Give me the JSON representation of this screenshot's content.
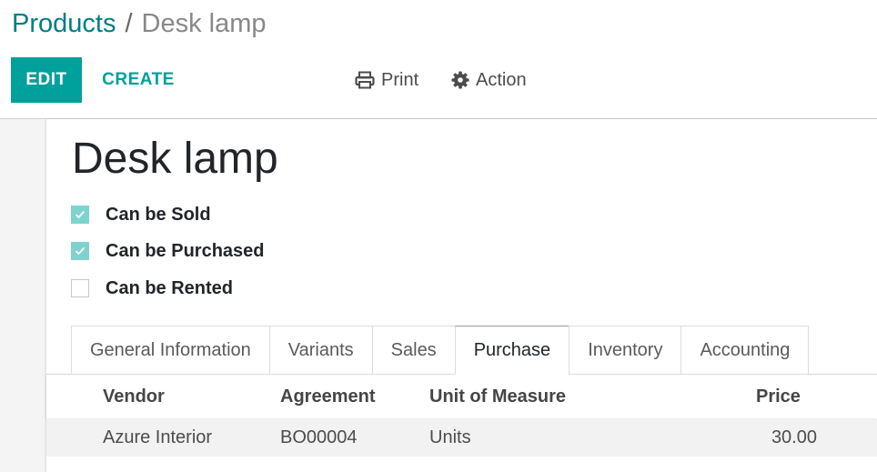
{
  "breadcrumb": {
    "parent": "Products",
    "separator": "/",
    "current": "Desk lamp"
  },
  "toolbar": {
    "edit_label": "EDIT",
    "create_label": "CREATE",
    "print_label": "Print",
    "action_label": "Action"
  },
  "icons": {
    "print": "print-icon",
    "action": "gear-icon"
  },
  "colors": {
    "primary": "#00a09d",
    "breadcrumb_link": "#017e84",
    "checkbox_checked": "#7ed3cf"
  },
  "product": {
    "name": "Desk lamp",
    "options": [
      {
        "label": "Can be Sold",
        "checked": true
      },
      {
        "label": "Can be Purchased",
        "checked": true
      },
      {
        "label": "Can be Rented",
        "checked": false
      }
    ]
  },
  "tabs": [
    {
      "label": "General Information",
      "active": false
    },
    {
      "label": "Variants",
      "active": false
    },
    {
      "label": "Sales",
      "active": false
    },
    {
      "label": "Purchase",
      "active": true
    },
    {
      "label": "Inventory",
      "active": false
    },
    {
      "label": "Accounting",
      "active": false
    }
  ],
  "vendor_table": {
    "columns": {
      "vendor": "Vendor",
      "agreement": "Agreement",
      "uom": "Unit of Measure",
      "price": "Price"
    },
    "rows": [
      {
        "vendor": "Azure Interior",
        "agreement": "BO00004",
        "uom": "Units",
        "price": "30.00"
      }
    ]
  }
}
